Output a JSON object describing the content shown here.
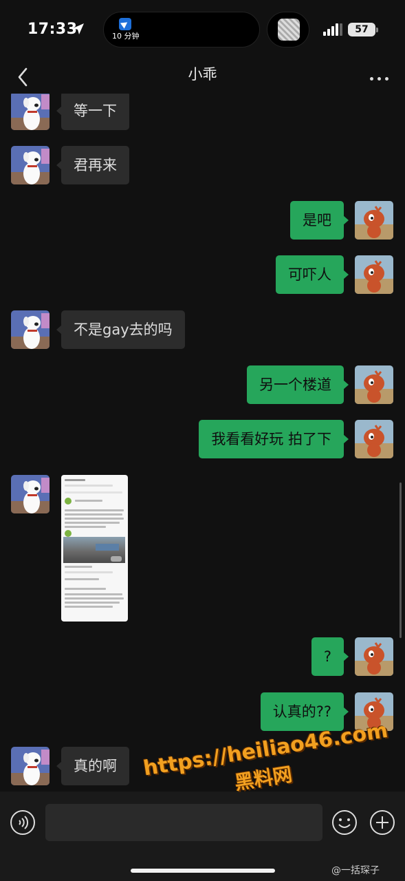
{
  "status_bar": {
    "time": "17:33",
    "island_label": "10 分钟",
    "battery": "57"
  },
  "nav": {
    "title": "小乖"
  },
  "messages": [
    {
      "side": "in",
      "kind": "text",
      "text": "等一下"
    },
    {
      "side": "in",
      "kind": "text",
      "text": "君再来"
    },
    {
      "side": "out",
      "kind": "text",
      "text": "是吧"
    },
    {
      "side": "out",
      "kind": "text",
      "text": "可吓人"
    },
    {
      "side": "in",
      "kind": "text",
      "text": "不是gay去的吗"
    },
    {
      "side": "out",
      "kind": "text",
      "text": "另一个楼道"
    },
    {
      "side": "out",
      "kind": "text",
      "text": "我看看好玩 拍了下"
    },
    {
      "side": "in",
      "kind": "image",
      "text": ""
    },
    {
      "side": "out",
      "kind": "text",
      "text": "?"
    },
    {
      "side": "out",
      "kind": "text",
      "text": "认真的??"
    },
    {
      "side": "in",
      "kind": "text",
      "text": "真的啊"
    }
  ],
  "input": {
    "placeholder": ""
  },
  "overlay": {
    "watermark_url": "https://heiliao46.com",
    "watermark_site": "黑料网",
    "credit": "@一括琛子"
  },
  "colors": {
    "background": "#111111",
    "incoming_bubble": "#2c2c2c",
    "outgoing_bubble": "#26a65b",
    "watermark": "#f2a020"
  },
  "icons": {
    "back": "chevron-left-icon",
    "more": "more-dots-icon",
    "voice": "voice-icon",
    "emoji": "emoji-icon",
    "plus": "plus-icon"
  }
}
